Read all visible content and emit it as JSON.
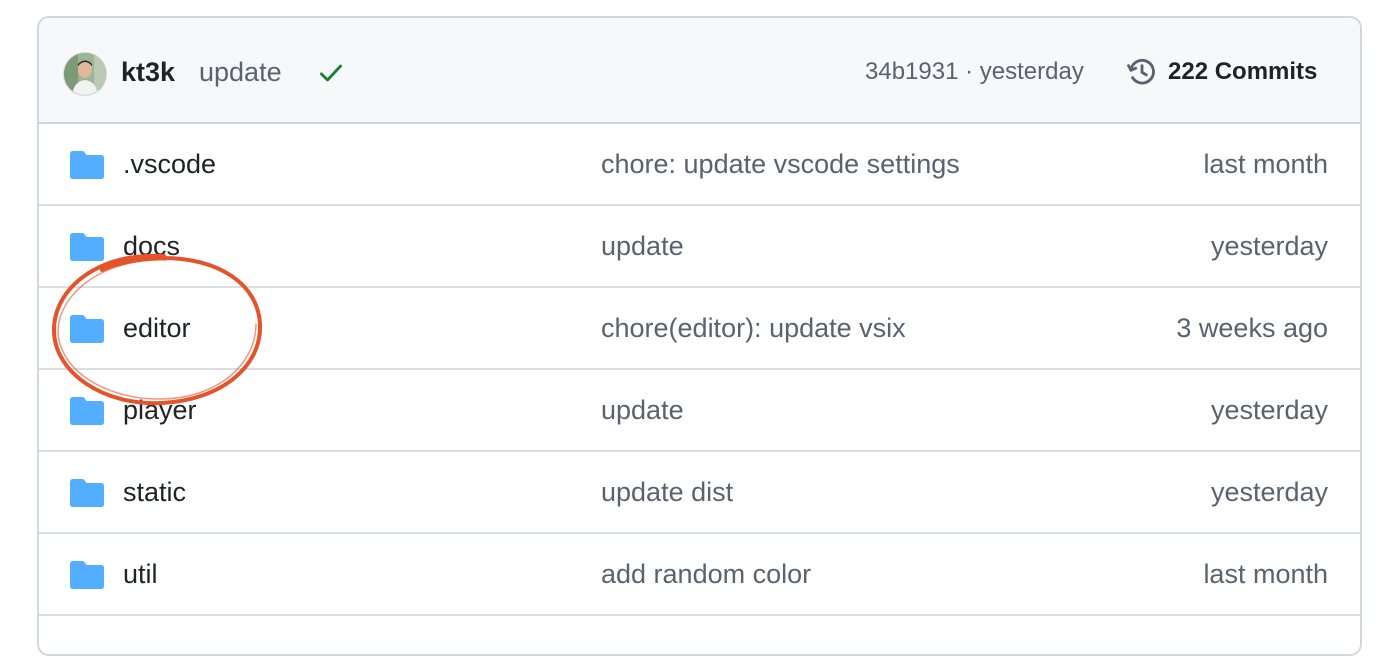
{
  "latest_commit": {
    "author": "kt3k",
    "message": "update",
    "status_icon": "check-icon",
    "status_color": "#1a7f37",
    "hash": "34b1931",
    "separator": "·",
    "time": "yesterday",
    "commits_count_label": "222 Commits"
  },
  "files": [
    {
      "name": ".vscode",
      "type": "folder",
      "commit_message": "chore: update vscode settings",
      "updated": "last month"
    },
    {
      "name": "docs",
      "type": "folder",
      "commit_message": "update",
      "updated": "yesterday"
    },
    {
      "name": "editor",
      "type": "folder",
      "commit_message": "chore(editor): update vsix",
      "updated": "3 weeks ago"
    },
    {
      "name": "player",
      "type": "folder",
      "commit_message": "update",
      "updated": "yesterday"
    },
    {
      "name": "static",
      "type": "folder",
      "commit_message": "update dist",
      "updated": "yesterday"
    },
    {
      "name": "util",
      "type": "folder",
      "commit_message": "add random color",
      "updated": "last month"
    }
  ],
  "colors": {
    "folder": "#54aeff",
    "annotation": "#e5532a",
    "border": "#d0d7de",
    "header_bg": "#f6f8fa"
  }
}
